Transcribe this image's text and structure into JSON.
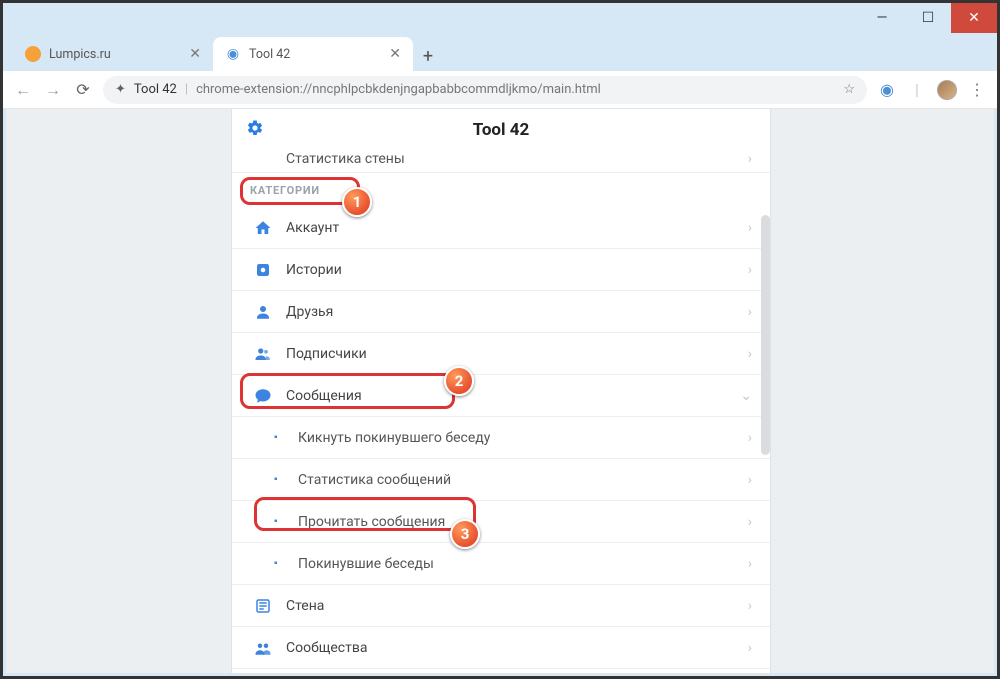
{
  "window": {
    "tabs": [
      {
        "label": "Lumpics.ru",
        "active": false
      },
      {
        "label": "Tool 42",
        "active": true
      }
    ],
    "address": {
      "site": "Tool 42",
      "path": "chrome-extension://nncphlpcbkdenjngapbabbcommdljkmo/main.html"
    }
  },
  "app": {
    "title": "Tool 42",
    "partial_top": "Статистика стены",
    "section_header": "КАТЕГОРИИ",
    "items": [
      {
        "icon": "home-icon",
        "label": "Аккаунт"
      },
      {
        "icon": "square-icon",
        "label": "Истории"
      },
      {
        "icon": "user-icon",
        "label": "Друзья"
      },
      {
        "icon": "users-icon",
        "label": "Подписчики"
      },
      {
        "icon": "chat-icon",
        "label": "Сообщения",
        "expanded": true
      },
      {
        "icon": "wall-icon",
        "label": "Стена"
      },
      {
        "icon": "community-icon",
        "label": "Сообщества"
      }
    ],
    "sub_items": [
      {
        "label": "Кикнуть покинувшего беседу"
      },
      {
        "label": "Статистика сообщений"
      },
      {
        "label": "Прочитать сообщения"
      },
      {
        "label": "Покинувшие беседы"
      }
    ]
  },
  "annotations": {
    "b1": "1",
    "b2": "2",
    "b3": "3"
  }
}
